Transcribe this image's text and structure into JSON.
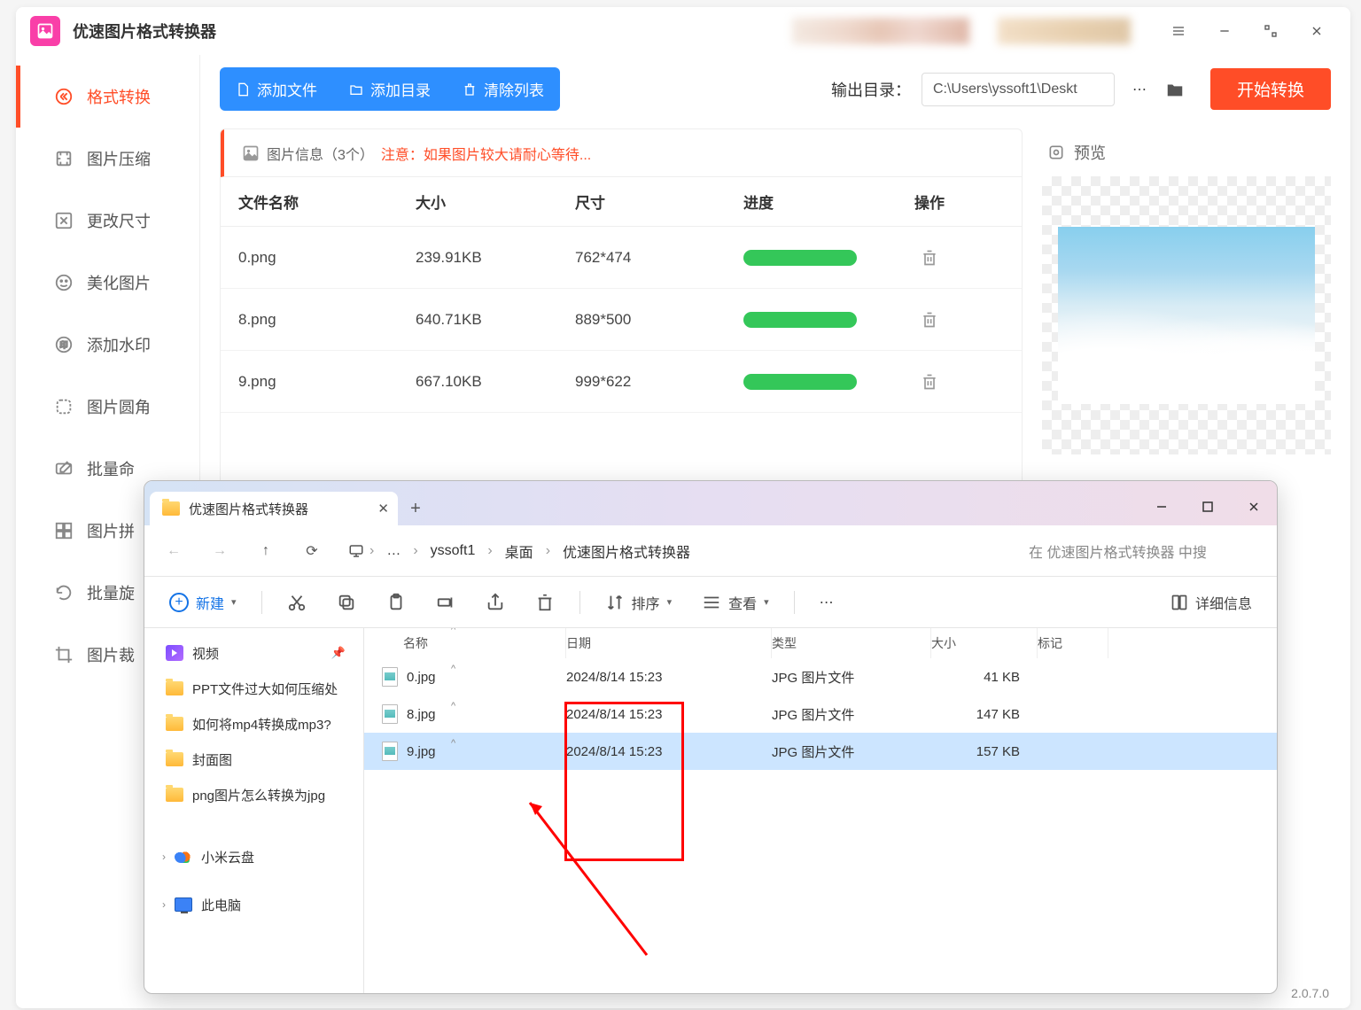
{
  "app": {
    "title": "优速图片格式转换器",
    "version": "2.0.7.0"
  },
  "sidebar": {
    "items": [
      {
        "label": "格式转换"
      },
      {
        "label": "图片压缩"
      },
      {
        "label": "更改尺寸"
      },
      {
        "label": "美化图片"
      },
      {
        "label": "添加水印"
      },
      {
        "label": "图片圆角"
      },
      {
        "label": "批量命"
      },
      {
        "label": "图片拼"
      },
      {
        "label": "批量旋"
      },
      {
        "label": "图片裁"
      }
    ]
  },
  "toolbar": {
    "add_file": "添加文件",
    "add_dir": "添加目录",
    "clear": "清除列表",
    "output_label": "输出目录：",
    "output_path": "C:\\Users\\yssoft1\\Deskt",
    "start": "开始转换"
  },
  "list": {
    "info_label": "图片信息（3个）",
    "note": "注意：如果图片较大请耐心等待...",
    "cols": {
      "name": "文件名称",
      "size": "大小",
      "dim": "尺寸",
      "prog": "进度",
      "act": "操作"
    },
    "rows": [
      {
        "name": "0.png",
        "size": "239.91KB",
        "dim": "762*474"
      },
      {
        "name": "8.png",
        "size": "640.71KB",
        "dim": "889*500"
      },
      {
        "name": "9.png",
        "size": "667.10KB",
        "dim": "999*622"
      }
    ]
  },
  "preview": {
    "label": "预览"
  },
  "explorer": {
    "tab_title": "优速图片格式转换器",
    "breadcrumb": [
      "…",
      "yssoft1",
      "桌面",
      "优速图片格式转换器"
    ],
    "search_placeholder": "在 优速图片格式转换器 中搜",
    "toolbar": {
      "new": "新建",
      "sort": "排序",
      "view": "查看",
      "details": "详细信息"
    },
    "side": {
      "videos": "视频",
      "folders": [
        "PPT文件过大如何压缩处",
        "如何将mp4转换成mp3?",
        "封面图",
        "png图片怎么转换为jpg"
      ],
      "cloud": "小米云盘",
      "pc": "此电脑"
    },
    "cols": {
      "name": "名称",
      "date": "日期",
      "type": "类型",
      "size": "大小",
      "tag": "标记"
    },
    "files": [
      {
        "name": "0.jpg",
        "date": "2024/8/14 15:23",
        "type": "JPG 图片文件",
        "size": "41 KB"
      },
      {
        "name": "8.jpg",
        "date": "2024/8/14 15:23",
        "type": "JPG 图片文件",
        "size": "147 KB"
      },
      {
        "name": "9.jpg",
        "date": "2024/8/14 15:23",
        "type": "JPG 图片文件",
        "size": "157 KB"
      }
    ]
  }
}
